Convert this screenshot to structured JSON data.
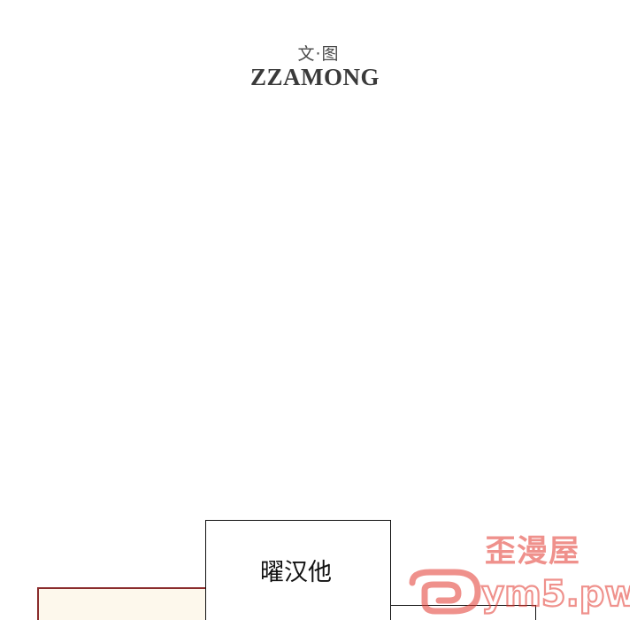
{
  "credits": {
    "label": "文·图",
    "author": "ZZAMONG"
  },
  "panel": {
    "speech": "曜汉他"
  },
  "watermark": {
    "title": "歪漫屋",
    "url": "ym5.pw",
    "color": "#e2382f"
  },
  "colors": {
    "panel_border": "#8a2c2c",
    "panel_fill": "#fdf8ec",
    "ink": "#111111"
  }
}
